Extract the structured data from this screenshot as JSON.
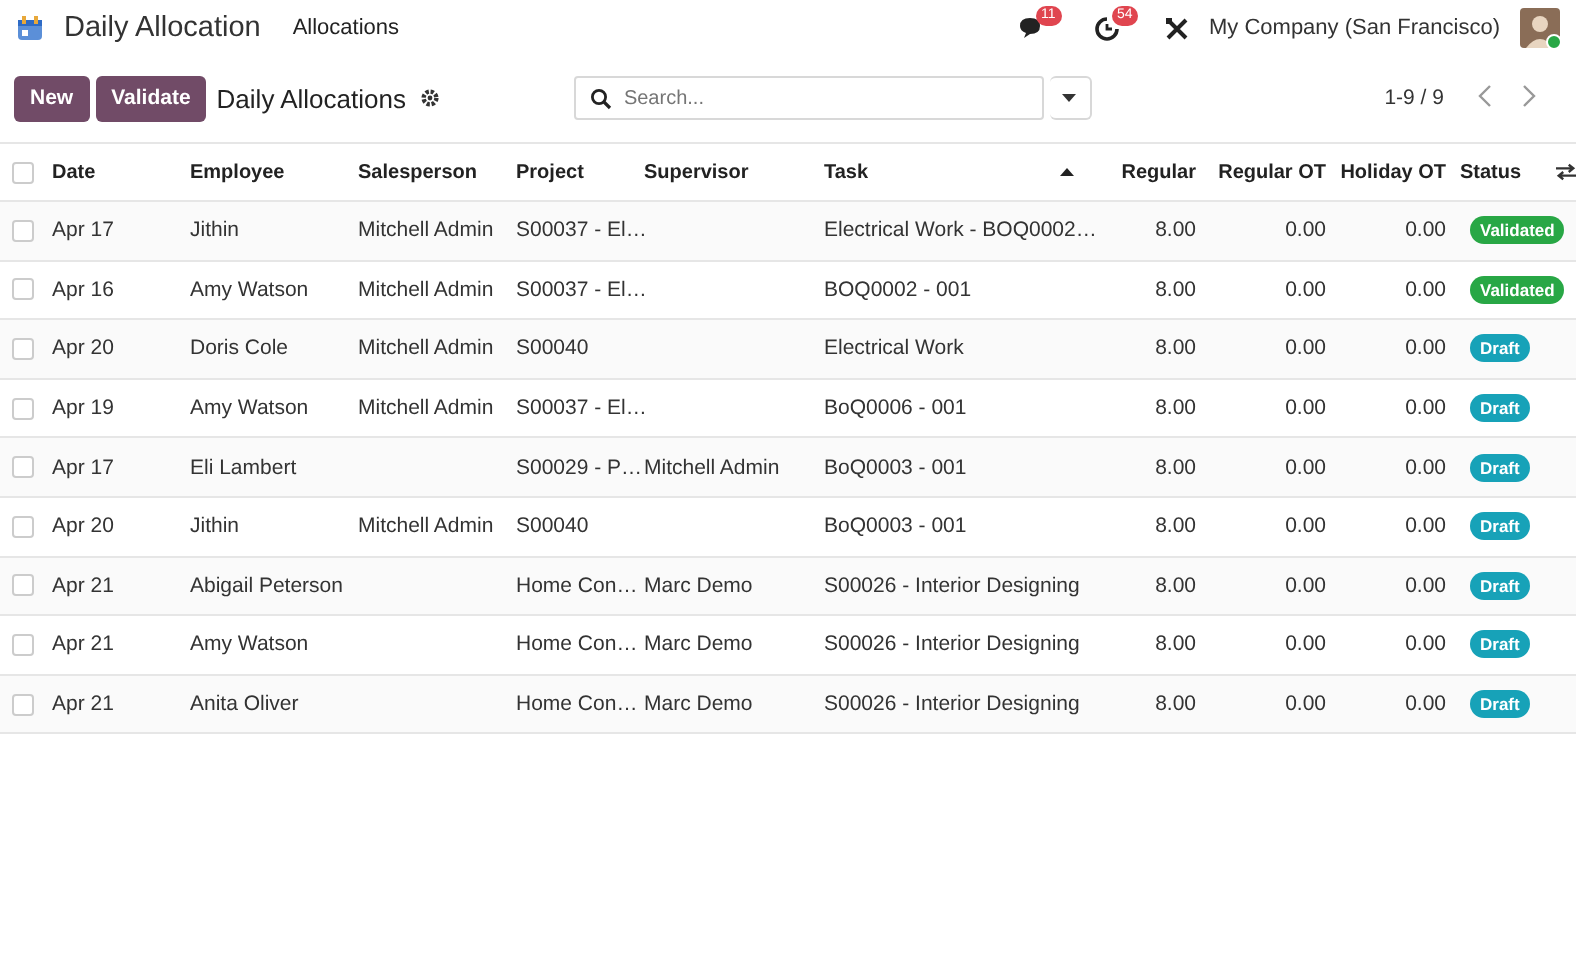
{
  "navbar": {
    "app_title": "Daily Allocation",
    "menu": [
      "Allocations"
    ],
    "messages_count": "11",
    "activities_count": "54",
    "company": "My Company (San Francisco)",
    "user_online": true
  },
  "control_bar": {
    "buttons": [
      "New",
      "Validate"
    ],
    "view_title": "Daily Allocations",
    "search": {
      "placeholder": "Search..."
    },
    "pager": "1-9 / 9"
  },
  "table": {
    "all_checked": false,
    "columns": [
      {
        "label": "Date",
        "kind": "text",
        "sorted": false
      },
      {
        "label": "Employee",
        "kind": "text",
        "sorted": false
      },
      {
        "label": "Salesperson",
        "kind": "text",
        "sorted": false
      },
      {
        "label": "Project",
        "kind": "text",
        "sorted": false
      },
      {
        "label": "Supervisor",
        "kind": "text",
        "sorted": false
      },
      {
        "label": "Task",
        "kind": "text",
        "sorted": true
      },
      {
        "label": "Regular",
        "kind": "number",
        "sorted": false
      },
      {
        "label": "Regular OT",
        "kind": "number",
        "sorted": false
      },
      {
        "label": "Holiday OT",
        "kind": "number",
        "sorted": false
      },
      {
        "label": "Status",
        "kind": "text",
        "sorted": false
      }
    ],
    "rows": [
      {
        "checked": false,
        "cells": [
          "Apr 17",
          "Jithin",
          "Mitchell Admin",
          "S00037 - El…",
          "",
          "Electrical Work - BOQ0002…",
          "8.00",
          "0.00",
          "0.00"
        ],
        "status": {
          "kind": "validated",
          "label": "Validated"
        }
      },
      {
        "checked": false,
        "cells": [
          "Apr 16",
          "Amy Watson",
          "Mitchell Admin",
          "S00037 - El…",
          "",
          "BOQ0002 - 001",
          "8.00",
          "0.00",
          "0.00"
        ],
        "status": {
          "kind": "validated",
          "label": "Validated"
        }
      },
      {
        "checked": false,
        "cells": [
          "Apr 20",
          "Doris Cole",
          "Mitchell Admin",
          "S00040",
          "",
          "Electrical Work",
          "8.00",
          "0.00",
          "0.00"
        ],
        "status": {
          "kind": "draft",
          "label": "Draft"
        }
      },
      {
        "checked": false,
        "cells": [
          "Apr 19",
          "Amy Watson",
          "Mitchell Admin",
          "S00037 - El…",
          "",
          "BoQ0006 - 001",
          "8.00",
          "0.00",
          "0.00"
        ],
        "status": {
          "kind": "draft",
          "label": "Draft"
        }
      },
      {
        "checked": false,
        "cells": [
          "Apr 17",
          "Eli Lambert",
          "",
          "S00029 - P…",
          "Mitchell Admin",
          "BoQ0003 - 001",
          "8.00",
          "0.00",
          "0.00"
        ],
        "status": {
          "kind": "draft",
          "label": "Draft"
        }
      },
      {
        "checked": false,
        "cells": [
          "Apr 20",
          "Jithin",
          "Mitchell Admin",
          "S00040",
          "",
          "BoQ0003 - 001",
          "8.00",
          "0.00",
          "0.00"
        ],
        "status": {
          "kind": "draft",
          "label": "Draft"
        }
      },
      {
        "checked": false,
        "cells": [
          "Apr 21",
          "Abigail Peterson",
          "",
          "Home Con…",
          "Marc Demo",
          "S00026 - Interior Designing",
          "8.00",
          "0.00",
          "0.00"
        ],
        "status": {
          "kind": "draft",
          "label": "Draft"
        }
      },
      {
        "checked": false,
        "cells": [
          "Apr 21",
          "Amy Watson",
          "",
          "Home Con…",
          "Marc Demo",
          "S00026 - Interior Designing",
          "8.00",
          "0.00",
          "0.00"
        ],
        "status": {
          "kind": "draft",
          "label": "Draft"
        }
      },
      {
        "checked": false,
        "cells": [
          "Apr 21",
          "Anita Oliver",
          "",
          "Home Con…",
          "Marc Demo",
          "S00026 - Interior Designing",
          "8.00",
          "0.00",
          "0.00"
        ],
        "status": {
          "kind": "draft",
          "label": "Draft"
        }
      }
    ]
  }
}
